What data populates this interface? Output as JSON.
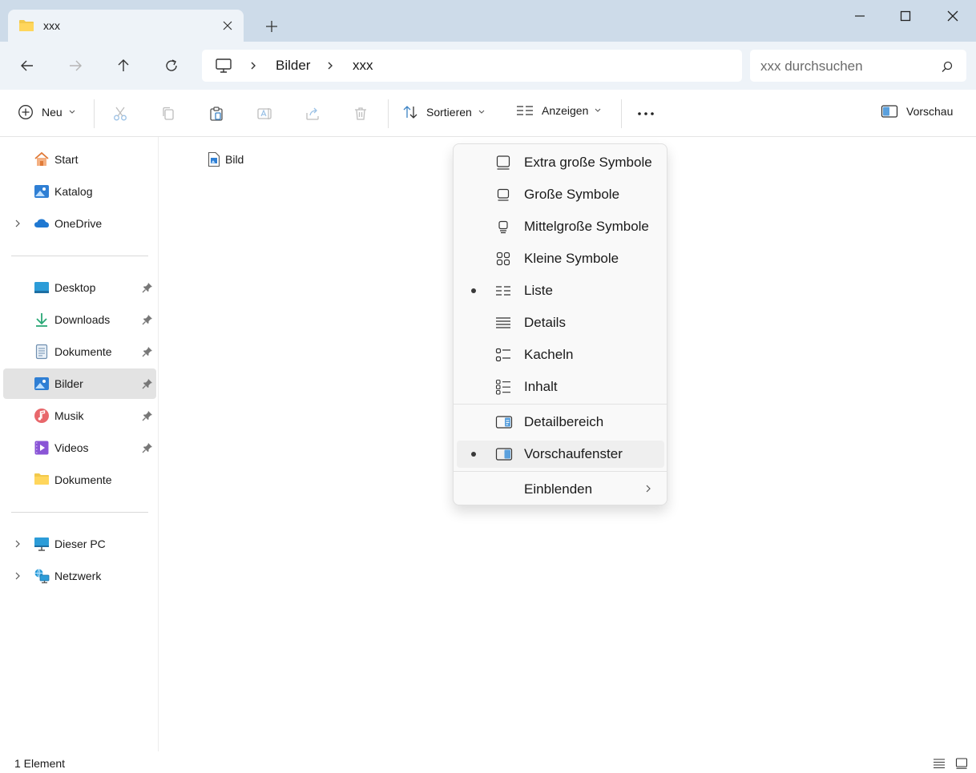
{
  "tab": {
    "title": "xxx",
    "icon": "folder-icon"
  },
  "window_controls": [
    "minimize-icon",
    "maximize-icon",
    "close-icon"
  ],
  "address": {
    "crumbs": [
      "Bilder",
      "xxx"
    ],
    "root_icon": "computer-icon"
  },
  "search": {
    "placeholder": "xxx durchsuchen"
  },
  "toolbar": {
    "new_label": "Neu",
    "sort_label": "Sortieren",
    "view_label": "Anzeigen",
    "preview_label": "Vorschau",
    "icons": [
      "cut-icon",
      "copy-icon",
      "paste-icon",
      "rename-icon",
      "share-icon",
      "delete-icon",
      "more-icon"
    ]
  },
  "sidebar": {
    "top": [
      {
        "label": "Start",
        "icon": "home-icon"
      },
      {
        "label": "Katalog",
        "icon": "gallery-icon"
      },
      {
        "label": "OneDrive",
        "icon": "cloud-icon"
      }
    ],
    "quick": [
      {
        "label": "Desktop",
        "icon": "desktop-icon"
      },
      {
        "label": "Downloads",
        "icon": "download-icon"
      },
      {
        "label": "Dokumente",
        "icon": "document-icon"
      },
      {
        "label": "Bilder",
        "icon": "pictures-icon"
      },
      {
        "label": "Musik",
        "icon": "music-icon"
      },
      {
        "label": "Videos",
        "icon": "video-icon"
      },
      {
        "label": "Dokumente",
        "icon": "folder-icon"
      }
    ],
    "bottom": [
      {
        "label": "Dieser PC",
        "icon": "pc-icon"
      },
      {
        "label": "Netzwerk",
        "icon": "network-icon"
      }
    ]
  },
  "content": {
    "items": [
      {
        "label": "Bild",
        "icon": "image-file-icon"
      }
    ]
  },
  "status": {
    "count": "1 Element"
  },
  "view_menu": {
    "items": [
      {
        "label": "Extra große Symbole",
        "icon": "extra-large-icons-icon",
        "checked": false
      },
      {
        "label": "Große Symbole",
        "icon": "large-icons-icon",
        "checked": false
      },
      {
        "label": "Mittelgroße Symbole",
        "icon": "medium-icons-icon",
        "checked": false
      },
      {
        "label": "Kleine Symbole",
        "icon": "small-icons-icon",
        "checked": false
      },
      {
        "label": "Liste",
        "icon": "list-icon",
        "checked": true
      },
      {
        "label": "Details",
        "icon": "details-icon",
        "checked": false
      },
      {
        "label": "Kacheln",
        "icon": "tiles-icon",
        "checked": false
      },
      {
        "label": "Inhalt",
        "icon": "content-icon",
        "checked": false
      }
    ],
    "panes": [
      {
        "label": "Detailbereich",
        "icon": "details-pane-icon",
        "checked": false
      },
      {
        "label": "Vorschaufenster",
        "icon": "preview-pane-icon",
        "checked": true
      }
    ],
    "show": {
      "label": "Einblenden"
    }
  }
}
